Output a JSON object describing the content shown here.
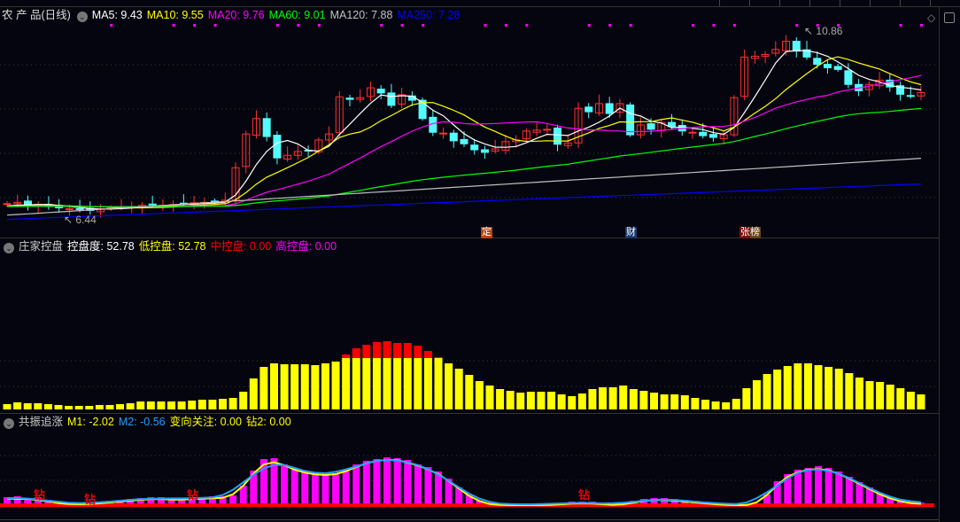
{
  "main": {
    "title": "农 产 品(日线)",
    "ma_labels": [
      {
        "label": "MA5: 9.43",
        "color": "#ffffff"
      },
      {
        "label": "MA10: 9.55",
        "color": "#ffff00"
      },
      {
        "label": "MA20: 9.76",
        "color": "#ff00ff"
      },
      {
        "label": "MA60: 9.01",
        "color": "#00ff00"
      },
      {
        "label": "MA120: 7.88",
        "color": "#c0c0c0"
      },
      {
        "label": "MA250: 7.28",
        "color": "#0000ff"
      }
    ],
    "high_label": "10.86",
    "low_label": "6.44",
    "signals": [
      {
        "label": "定",
        "color": "#c04000"
      },
      {
        "label": "财",
        "color": "#1a3a6a"
      },
      {
        "label": "张榜",
        "color": "#7a1010"
      }
    ]
  },
  "panel2": {
    "title": "庄家控盘",
    "labels": [
      {
        "label": "控盘度: 52.78",
        "color": "#ffffff"
      },
      {
        "label": "低控盘: 52.78",
        "color": "#ffff00"
      },
      {
        "label": "中控盘: 0.00",
        "color": "#ff0000"
      },
      {
        "label": "高控盘: 0.00",
        "color": "#ff00ff"
      }
    ]
  },
  "panel3": {
    "title": "共振追涨",
    "labels": [
      {
        "label": "M1: -2.02",
        "color": "#ffff00"
      },
      {
        "label": "M2: -0.56",
        "color": "#1ea0ff"
      },
      {
        "label": "变向关注: 0.00",
        "color": "#ffff00"
      },
      {
        "label": "钻2: 0.00",
        "color": "#ffff00"
      }
    ],
    "marker": "钻"
  },
  "colors": {
    "up": "#ff3030",
    "down": "#54fcfc",
    "bg": "#05050f"
  },
  "chart_data": {
    "type": "candlestick",
    "price_range": [
      6.3,
      11.0
    ],
    "closes": [
      6.82,
      6.85,
      6.78,
      6.8,
      6.75,
      6.72,
      6.7,
      6.68,
      6.66,
      6.7,
      6.72,
      6.75,
      6.74,
      6.78,
      6.8,
      6.78,
      6.8,
      6.82,
      6.84,
      6.85,
      6.86,
      6.9,
      7.66,
      8.45,
      8.81,
      8.39,
      7.89,
      7.95,
      8.04,
      8.06,
      8.31,
      8.45,
      9.32,
      9.26,
      9.3,
      9.53,
      9.41,
      9.12,
      9.37,
      9.24,
      8.81,
      8.49,
      8.47,
      8.29,
      8.22,
      8.08,
      8.02,
      8.1,
      8.27,
      8.31,
      8.52,
      8.54,
      8.56,
      8.21,
      8.24,
      9.05,
      8.97,
      9.16,
      8.93,
      9.16,
      8.43,
      8.66,
      8.56,
      8.72,
      8.62,
      8.52,
      8.49,
      8.41,
      8.37,
      8.43,
      9.3,
      10.25,
      10.27,
      10.31,
      10.43,
      10.62,
      10.39,
      10.25,
      10.08,
      10.0,
      9.96,
      9.61,
      9.46,
      9.61,
      9.71,
      9.55,
      9.38,
      9.34,
      9.42
    ],
    "ma120_range": [
      6.55,
      7.88
    ],
    "ma250_range": [
      6.45,
      7.28
    ],
    "control_levels": [
      6,
      8,
      7,
      7,
      6,
      5,
      4,
      4,
      4,
      5,
      5,
      6,
      7,
      9,
      9,
      9,
      9,
      9,
      10,
      11,
      11,
      12,
      13,
      20,
      35,
      48,
      52,
      51,
      51,
      51,
      50,
      52,
      54,
      58,
      58,
      58,
      58,
      58,
      58,
      58,
      58,
      58,
      58,
      52,
      46,
      39,
      32,
      27,
      23,
      21,
      19,
      20,
      20,
      20,
      17,
      15,
      18,
      23,
      25,
      25,
      27,
      23,
      21,
      19,
      17,
      17,
      16,
      13,
      11,
      9,
      8,
      12,
      24,
      33,
      40,
      45,
      49,
      52,
      52,
      50,
      48,
      46,
      41,
      36,
      32,
      31,
      28,
      24,
      20,
      17
    ],
    "high_control_levels": [
      0,
      0,
      0,
      0,
      0,
      0,
      0,
      0,
      0,
      0,
      0,
      0,
      0,
      0,
      0,
      0,
      0,
      0,
      0,
      0,
      0,
      0,
      0,
      0,
      0,
      0,
      0,
      0,
      0,
      0,
      0,
      0,
      0,
      62,
      69,
      73,
      76,
      77,
      75,
      75,
      72,
      66,
      59,
      0,
      0,
      0,
      0,
      0,
      0,
      0,
      0,
      0,
      0,
      0,
      0,
      0,
      0,
      0,
      0,
      0,
      0,
      0,
      0,
      0,
      0,
      0,
      0,
      0,
      0,
      0,
      0,
      0,
      0,
      0,
      0,
      0,
      0,
      0,
      0,
      0,
      0,
      0,
      0,
      0,
      0,
      0,
      0,
      0,
      0,
      0
    ],
    "resonance": [
      7,
      8,
      6,
      7,
      4,
      2,
      1,
      1,
      1,
      2,
      3,
      4,
      5,
      6,
      7,
      7,
      6,
      6,
      7,
      7,
      8,
      8,
      9,
      20,
      37,
      50,
      51,
      44,
      40,
      36,
      34,
      34,
      34,
      37,
      44,
      48,
      50,
      52,
      51,
      49,
      44,
      41,
      36,
      28,
      18,
      10,
      3,
      1,
      0,
      0,
      0,
      0,
      0,
      0,
      1,
      2,
      2,
      2,
      1,
      0,
      0,
      3,
      5,
      6,
      6,
      5,
      4,
      3,
      2,
      1,
      0,
      0,
      0,
      0,
      10,
      25,
      33,
      38,
      40,
      42,
      40,
      36,
      30,
      24,
      18,
      12,
      7,
      4,
      2,
      1
    ]
  }
}
